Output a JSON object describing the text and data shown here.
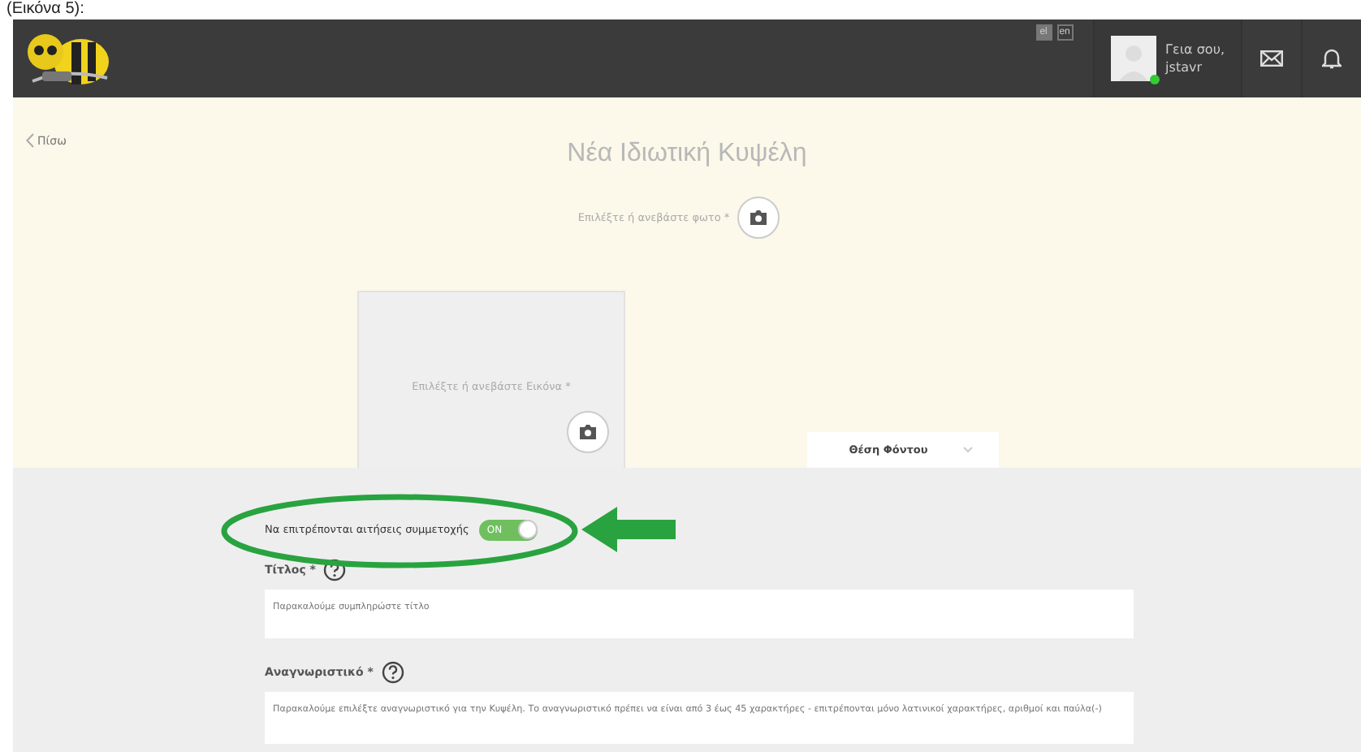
{
  "caption": "(Εικόνα 5):",
  "header": {
    "languages": [
      {
        "label": "el",
        "selected": true
      },
      {
        "label": "en",
        "selected": false
      }
    ],
    "greeting": "Γεια σου,",
    "username": "jstavr",
    "online": true
  },
  "back": "Πίσω",
  "title": "Νέα Ιδιωτική Κυψέλη",
  "photo_label": "Επιλέξτε ή ανεβάστε φωτο *",
  "image_label": "Επιλέξτε ή ανεβάστε Εικόνα *",
  "background_position": "Θέση Φόντου",
  "applications_toggle": {
    "label": "Να επιτρέπονται αιτήσεις συμμετοχής",
    "state_text": "ON",
    "on": true
  },
  "fields": [
    {
      "label": "Τίτλος *",
      "placeholder": "Παρακαλούμε συμπληρώστε τίτλο"
    },
    {
      "label": "Αναγνωριστικό *",
      "placeholder": "Παρακαλούμε επιλέξτε αναγνωριστικό για την Κυψέλη. Το αναγνωριστικό πρέπει να είναι από 3 έως 45 χαρακτήρες - επιτρέπονται μόνο λατινικοί χαρακτήρες, αριθμοί και παύλα(-)"
    }
  ]
}
